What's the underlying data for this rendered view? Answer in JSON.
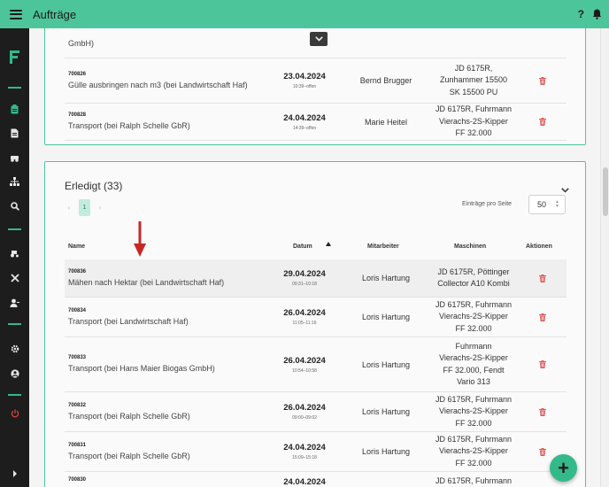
{
  "app": {
    "title": "Aufträge"
  },
  "topbar": {
    "help": "?",
    "menu_icon": "hamburger-icon",
    "bell_icon": "bell-icon"
  },
  "sidebar": {
    "logo": "F",
    "items": [
      "clipboard-icon",
      "document-icon",
      "tractor-group-icon",
      "hierarchy-icon",
      "search-icon",
      "tractor-icon",
      "tools-icon",
      "user-icon",
      "gear-icon",
      "account-icon",
      "power-icon",
      "expand-icon"
    ]
  },
  "open_section": {
    "partial_row_text": "GmbH)",
    "rows": [
      {
        "id": "700826",
        "title": "Gülle ausbringen nach m3 (bei Landwirtschaft Haf)",
        "date": "23.04.2024",
        "time": "10:39–offen",
        "staff": "Bernd Brugger",
        "machines": [
          "JD 6175R,",
          "Zunhammer 15500",
          "SK 15500 PU"
        ]
      },
      {
        "id": "700828",
        "title": "Transport (bei Ralph Schelle GbR)",
        "date": "24.04.2024",
        "time": "14:39–offen",
        "staff": "Marie Heitel",
        "machines": [
          "JD 6175R, Fuhrmann",
          "Vierachs-2S-Kipper",
          "FF 32.000"
        ]
      }
    ]
  },
  "done_section": {
    "title": "Erledigt (33)",
    "pagination": {
      "prev": "‹",
      "current": "1",
      "next": "›"
    },
    "per_page_label": "Einträge pro Seite",
    "per_page_value": "50",
    "columns": {
      "name": "Name",
      "date": "Datum",
      "staff": "Mitarbeiter",
      "machines": "Maschinen",
      "actions": "Aktionen"
    },
    "sort": {
      "column": "Datum",
      "direction": "ascending"
    },
    "rows": [
      {
        "id": "700836",
        "title": "Mähen nach Hektar (bei Landwirtschaft Haf)",
        "date": "29.04.2024",
        "time": "09:31–10:18",
        "staff": "Loris Hartung",
        "machines": [
          "JD 6175R, Pöttinger",
          "Collector A10 Kombi"
        ]
      },
      {
        "id": "700834",
        "title": "Transport (bei Landwirtschaft Haf)",
        "date": "26.04.2024",
        "time": "11:05–11:16",
        "staff": "Loris Hartung",
        "machines": [
          "JD 6175R, Fuhrmann",
          "Vierachs-2S-Kipper",
          "FF 32.000"
        ]
      },
      {
        "id": "700833",
        "title": "Transport (bei Hans Maier Biogas GmbH)",
        "date": "26.04.2024",
        "time": "10:54–10:58",
        "staff": "Loris Hartung",
        "machines": [
          "Fuhrmann",
          "Vierachs-2S-Kipper",
          "FF 32.000, Fendt",
          "Vario 313"
        ]
      },
      {
        "id": "700832",
        "title": "Transport (bei Ralph Schelle GbR)",
        "date": "26.04.2024",
        "time": "09:00–09:02",
        "staff": "Loris Hartung",
        "machines": [
          "JD 6175R, Fuhrmann",
          "Vierachs-2S-Kipper",
          "FF 32.000"
        ]
      },
      {
        "id": "700831",
        "title": "Transport (bei Ralph Schelle GbR)",
        "date": "24.04.2024",
        "time": "15:09–15:18",
        "staff": "Loris Hartung",
        "machines": [
          "JD 6175R, Fuhrmann",
          "Vierachs-2S-Kipper",
          "FF 32.000"
        ]
      },
      {
        "id": "700830",
        "title": "",
        "date": "24.04.2024",
        "time": "",
        "staff": "",
        "machines": [
          "JD 6175R, Fuhrmann"
        ]
      }
    ]
  },
  "fab": {
    "label": "+"
  },
  "colors": {
    "accent": "#4dc59b",
    "sidebar": "#1d1d1d",
    "delete": "#e05a5a",
    "annotation_arrow": "#c62828"
  }
}
